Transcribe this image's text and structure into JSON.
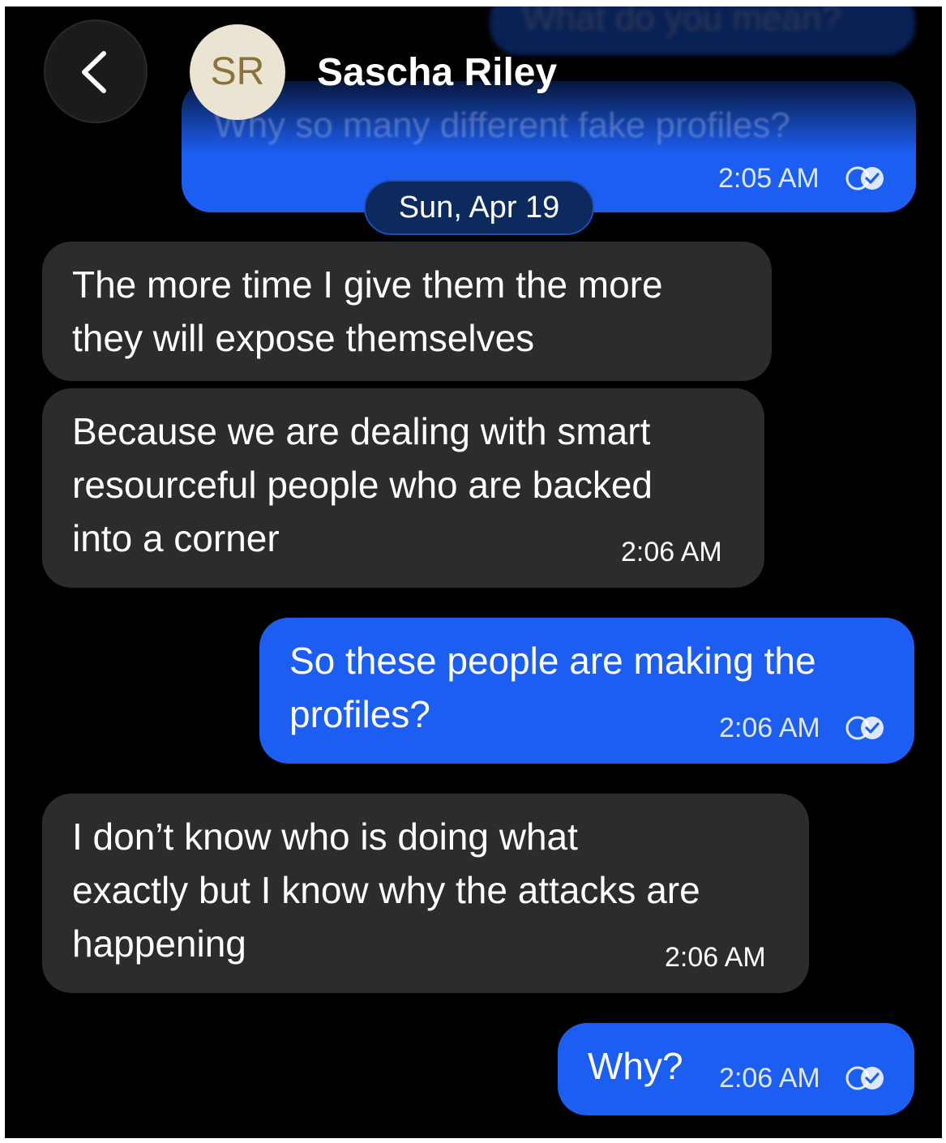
{
  "header": {
    "avatar_initials": "SR",
    "contact_name": "Sascha Riley",
    "back_icon": "chevron-left-icon"
  },
  "date_separator": "Sun, Apr 19",
  "colors": {
    "background": "#000000",
    "incoming_bubble": "#2c2c2e",
    "outgoing_bubble": "#1c5ef2",
    "avatar_bg": "#eae4d3",
    "avatar_text": "#8a7338"
  },
  "partial_messages": [
    {
      "text": "What do you mean?"
    },
    {
      "text": "Why so many different fake profiles?",
      "time": "2:05 AM",
      "status_icon": "read-receipt-icon"
    }
  ],
  "messages": [
    {
      "direction": "incoming",
      "lines": [
        "The more time I give them the more",
        "they will expose themselves"
      ]
    },
    {
      "direction": "incoming",
      "lines": [
        "Because we are dealing with smart",
        "resourceful people who are backed",
        "into a corner"
      ],
      "time": "2:06 AM"
    },
    {
      "direction": "outgoing",
      "lines": [
        "So these people are making the",
        "profiles?"
      ],
      "time": "2:06 AM",
      "status_icon": "read-receipt-icon"
    },
    {
      "direction": "incoming",
      "lines": [
        "I don’t know who is doing what",
        "exactly but I know why the attacks are",
        "happening"
      ],
      "time": "2:06 AM"
    },
    {
      "direction": "outgoing",
      "lines": [
        "Why?"
      ],
      "time": "2:06 AM",
      "status_icon": "read-receipt-icon"
    }
  ]
}
